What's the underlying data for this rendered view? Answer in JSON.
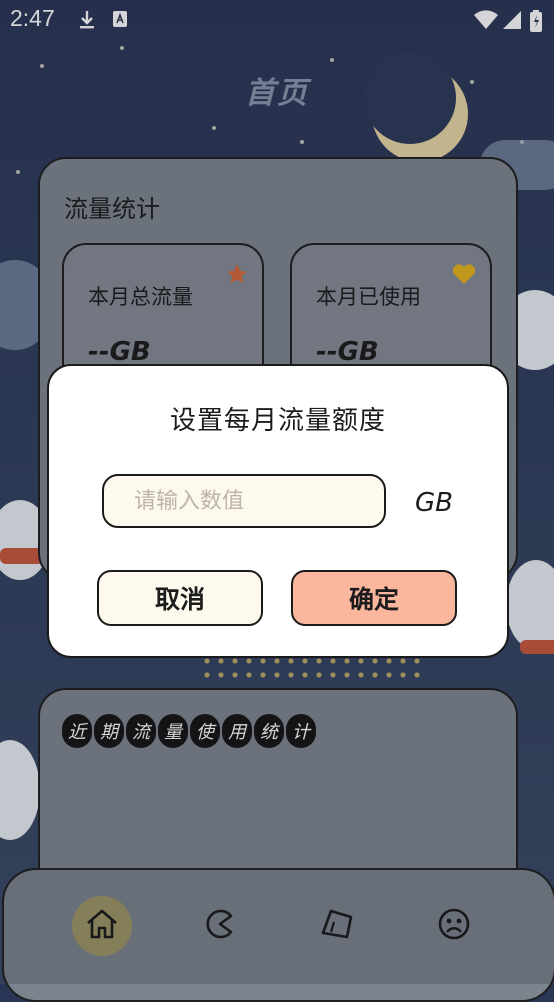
{
  "status_bar": {
    "time": "2:47",
    "icons": [
      "download-icon",
      "a-badge-icon",
      "wifi-icon",
      "signal-icon",
      "battery-icon"
    ]
  },
  "header": {
    "title": "首页"
  },
  "stats": {
    "title": "流量统计",
    "total": {
      "label": "本月总流量",
      "value": "--GB",
      "icon": "star-icon"
    },
    "used": {
      "label": "本月已使用",
      "value": "--GB",
      "icon": "heart-icon"
    }
  },
  "recent": {
    "title_chars": [
      "近",
      "期",
      "流",
      "量",
      "使",
      "用",
      "统",
      "计"
    ]
  },
  "bottom_nav": {
    "items": [
      {
        "name": "home-icon",
        "active": true
      },
      {
        "name": "pacman-icon",
        "active": false
      },
      {
        "name": "tag-icon",
        "active": false
      },
      {
        "name": "face-icon",
        "active": false
      }
    ]
  },
  "dialog": {
    "title": "设置每月流量额度",
    "input_placeholder": "请输入数值",
    "input_value": "",
    "unit": "GB",
    "cancel_label": "取消",
    "confirm_label": "确定"
  },
  "colors": {
    "confirm_button": "#fbb79e",
    "cancel_button": "#fdf9ec",
    "nav_active": "#9d9664",
    "star": "#d86a3a",
    "heart": "#e7b51c"
  }
}
